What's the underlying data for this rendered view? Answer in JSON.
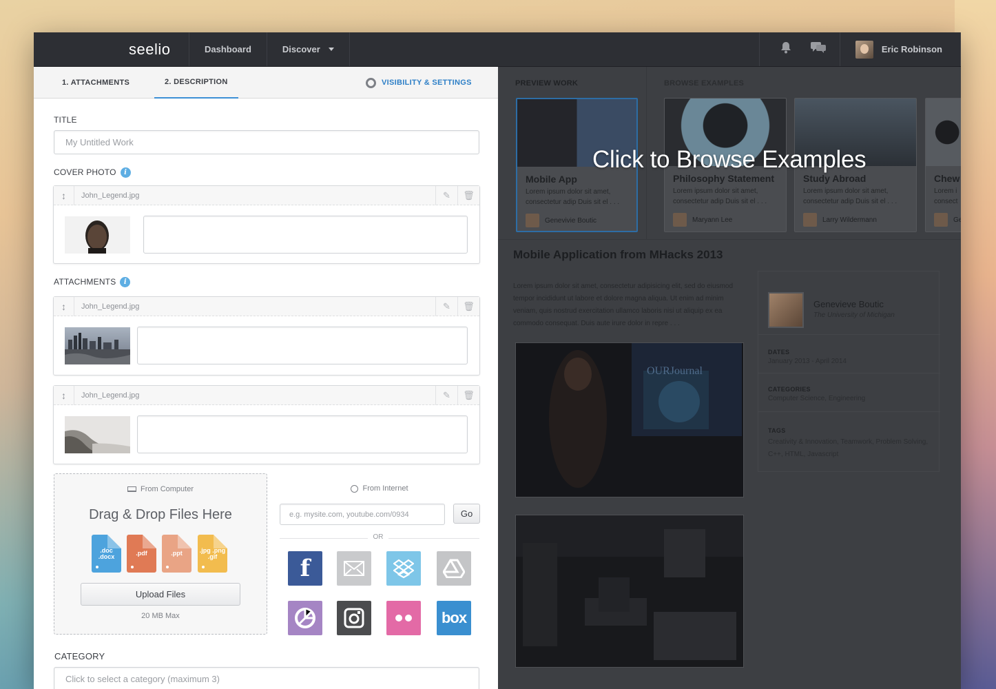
{
  "app": {
    "logo": "seelio"
  },
  "nav": {
    "items": [
      {
        "label": "Dashboard"
      },
      {
        "label": "Discover"
      }
    ],
    "user_name": "Eric Robinson"
  },
  "tabs": [
    {
      "label": "1. ATTACHMENTS"
    },
    {
      "label": "2. DESCRIPTION"
    },
    {
      "label": "VISIBILITY & SETTINGS"
    }
  ],
  "form": {
    "title_label": "TITLE",
    "title_placeholder": "My Untitled Work",
    "cover_label": "COVER PHOTO",
    "cover_file": "John_Legend.jpg",
    "attachments_label": "ATTACHMENTS",
    "attachments": [
      {
        "file": "John_Legend.jpg"
      },
      {
        "file": "John_Legend.jpg"
      }
    ],
    "upload": {
      "from_computer": "From Computer",
      "drag_drop": "Drag & Drop Files Here",
      "filetypes": [
        {
          "label": ".doc .docx",
          "color": "#4da3dd"
        },
        {
          "label": ".pdf",
          "color": "#e07a55"
        },
        {
          "label": ".ppt",
          "color": "#e9a485"
        },
        {
          "label": ".jpg .png .gif",
          "color": "#f2bc4e"
        }
      ],
      "button": "Upload Files",
      "max": "20 MB Max"
    },
    "internet": {
      "label": "From Internet",
      "placeholder": "e.g. mysite.com, youtube.com/0934",
      "go": "Go",
      "or": "OR",
      "services": [
        {
          "icon": "facebook-icon",
          "color": "#3b5a98"
        },
        {
          "icon": "email-icon",
          "color": "#c9cacc"
        },
        {
          "icon": "dropbox-icon",
          "color": "#7ec6e8"
        },
        {
          "icon": "google-drive-icon",
          "color": "#c4c5c7"
        },
        {
          "icon": "picasa-icon",
          "color": "#a585c4"
        },
        {
          "icon": "instagram-icon",
          "color": "#4b4c4e"
        },
        {
          "icon": "flickr-icon",
          "color": "#e36aa6"
        },
        {
          "icon": "box-icon",
          "color": "#3a8fd0",
          "label": "box"
        }
      ]
    },
    "category_label": "CATEGORY",
    "category_placeholder": "Click to select a category (maximum 3)"
  },
  "preview": {
    "preview_head": "PREVIEW WORK",
    "browse_head": "BROWSE EXAMPLES",
    "overlay": "Click to Browse Examples",
    "cards": [
      {
        "title": "Mobile App",
        "desc": "Lorem ipsum dolor sit amet, consectetur adip Duis sit el . . .",
        "author": "Genevivie Boutic"
      },
      {
        "title": "Philosophy Statement",
        "desc": "Lorem ipsum dolor sit amet, consectetur adip Duis sit el . . .",
        "author": "Maryann Lee"
      },
      {
        "title": "Study Abroad",
        "desc": "Lorem ipsum dolor sit amet, consectetur adip Duis sit el . . .",
        "author": "Larry Wildermann"
      },
      {
        "title": "Chew",
        "desc": "Lorem i consect",
        "author": "Ge"
      }
    ],
    "work_title": "Mobile Application from MHacks 2013",
    "work_desc": "Lorem ipsum dolor sit amet, consectetur adipisicing elit, sed do eiusmod tempor incididunt ut labore et dolore magna aliqua. Ut enim ad minim veniam, quis nostrud exercitation ullamco laboris nisi ut aliquip ex ea commodo consequat. Duis aute irure dolor in repre . . .",
    "author": {
      "name": "Genevieve Boutic",
      "school": "The University of Michigan"
    },
    "dates_h": "DATES",
    "dates": "January 2013 - April 2014",
    "categories_h": "CATEGORIES",
    "categories": "Computer Science, Engineering",
    "tags_h": "TAGS",
    "tags": "Creativity & Innovation, Teamwork, Problem Solving, C++, HTML, Javascript",
    "photo_text": "OURJournal"
  }
}
